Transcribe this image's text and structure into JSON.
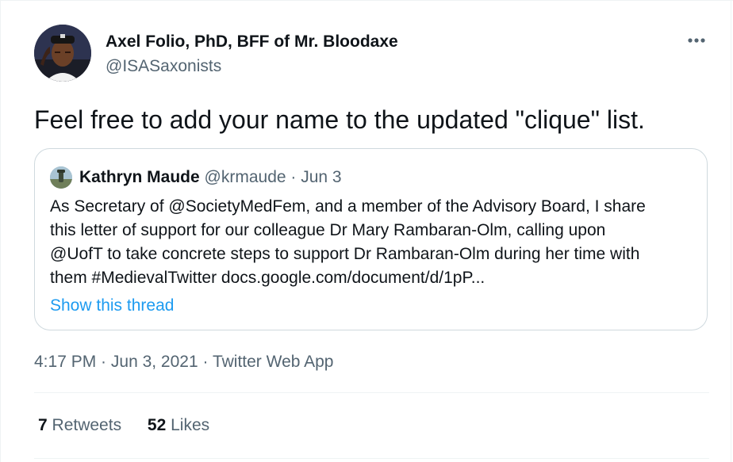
{
  "author": {
    "name": "Axel Folio, PhD, BFF of Mr. Bloodaxe",
    "handle": "@ISASaxonists",
    "avatar_icon": "profile-photo-icon"
  },
  "more_icon": "more-options-icon",
  "tweet_text": "Feel free to add your name to the updated \"clique\" list.",
  "quoted": {
    "name": "Kathryn Maude",
    "handle": "@krmaude",
    "separator": " · ",
    "date": "Jun 3",
    "avatar_icon": "profile-photo-icon",
    "text_lines": [
      "As Secretary of @SocietyMedFem, and a member of the Advisory Board, I share",
      "this letter of support for our colleague Dr Mary Rambaran-Olm, calling upon",
      "@UofT to take concrete steps to support Dr Rambaran-Olm during her time with",
      "them #MedievalTwitter docs.google.com/document/d/1pP..."
    ],
    "show_thread": "Show this thread"
  },
  "meta": {
    "time": "4:17 PM",
    "date": "Jun 3, 2021",
    "source": "Twitter Web App",
    "separator": " · "
  },
  "stats": {
    "retweets_count": "7",
    "retweets_label": "Retweets",
    "likes_count": "52",
    "likes_label": "Likes"
  },
  "colors": {
    "primary_text": "#0f1419",
    "secondary_text": "#536471",
    "link": "#1d9bf0",
    "border": "#cfd9de"
  }
}
